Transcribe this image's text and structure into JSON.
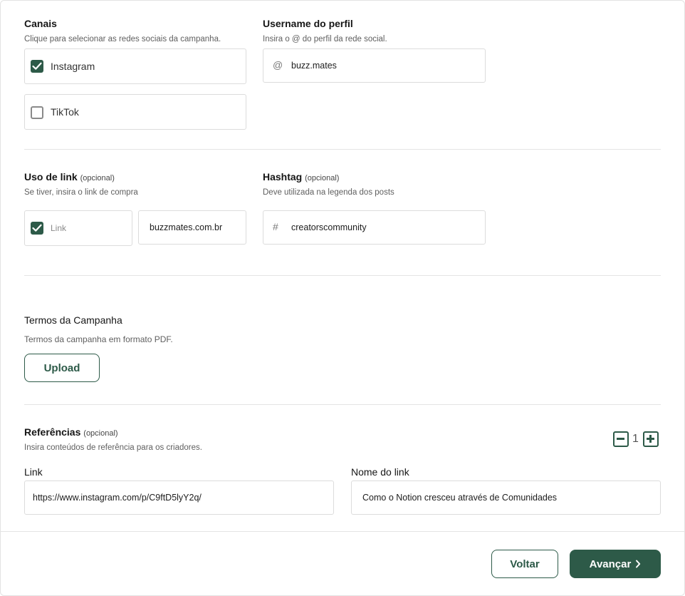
{
  "canais": {
    "title": "Canais",
    "subtitle": "Clique para selecionar as redes sociais da campanha.",
    "options": [
      {
        "label": "Instagram",
        "checked": true
      },
      {
        "label": "TikTok",
        "checked": false
      }
    ]
  },
  "username": {
    "title": "Username do perfil",
    "subtitle": "Insira o @ do perfil da rede social.",
    "prefix": "@",
    "value": "buzz.mates"
  },
  "link_usage": {
    "title": "Uso de link",
    "optional": "(opcional)",
    "subtitle": "Se tiver, insira o link de compra",
    "checkbox_label": "Link",
    "checked": true,
    "value": "buzzmates.com.br"
  },
  "hashtag": {
    "title": "Hashtag",
    "optional": "(opcional)",
    "subtitle": "Deve utilizada na legenda dos posts",
    "prefix": "#",
    "value": "creatorscommunity"
  },
  "terms": {
    "title": "Termos da Campanha",
    "subtitle": "Termos da campanha em formato PDF.",
    "upload_label": "Upload"
  },
  "references": {
    "title": "Referências",
    "optional": "(opcional)",
    "subtitle": "Insira conteúdos de referência para os criadores.",
    "count": "1",
    "link_label": "Link",
    "link_value": "https://www.instagram.com/p/C9ftD5lyY2q/",
    "name_label": "Nome do link",
    "name_value": "Como o Notion cresceu através de Comunidades"
  },
  "footer": {
    "back_label": "Voltar",
    "next_label": "Avançar"
  },
  "colors": {
    "accent": "#2d5a48",
    "border": "#dcdcdc",
    "muted_text": "#5f5f5f"
  }
}
